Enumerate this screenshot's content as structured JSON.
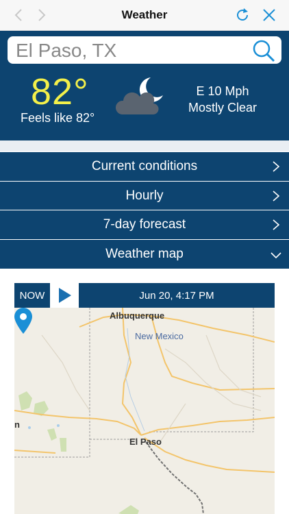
{
  "nav": {
    "title": "Weather"
  },
  "search": {
    "value": "El Paso, TX",
    "placeholder": ""
  },
  "current": {
    "temperature": "82°",
    "feels_like": "Feels like 82°",
    "wind": "E 10 Mph",
    "condition": "Mostly Clear",
    "icon": "moon-cloud-icon"
  },
  "menu": {
    "items": [
      {
        "label": "Current conditions",
        "chevron": "chevron-right-icon"
      },
      {
        "label": "Hourly",
        "chevron": "chevron-right-icon"
      },
      {
        "label": "7-day forecast",
        "chevron": "chevron-right-icon"
      },
      {
        "label": "Weather map",
        "chevron": "chevron-down-icon"
      }
    ]
  },
  "map": {
    "now_label": "NOW",
    "timestamp": "Jun 20, 4:17 PM",
    "places": {
      "albuquerque": "Albuquerque",
      "new_mexico": "New Mexico",
      "el_paso": "El Paso",
      "partial_left": "n"
    }
  },
  "colors": {
    "panel": "#0d4470",
    "temperature": "#f3f04a",
    "accent": "#1a8fd6"
  }
}
